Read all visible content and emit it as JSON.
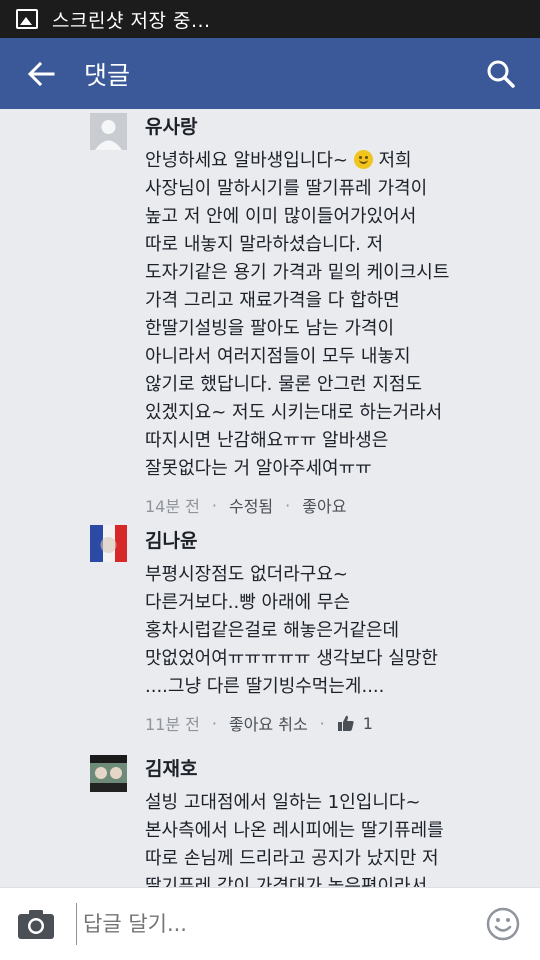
{
  "status_bar": {
    "text": "스크린샷 저장 중..."
  },
  "app_bar": {
    "title": "댓글"
  },
  "comments": [
    {
      "author": "유사랑",
      "lines": [
        "안녕하세요 알바생입니다~",
        "사장님이 말하시기를 딸기퓨레 가격이",
        "높고 저 안에 이미 많이들어가있어서",
        "따로 내놓지 말라하셨습니다. 저",
        "도자기같은 용기 가격과 밑의 케이크시트",
        "가격 그리고 재료가격을 다 합하면",
        "한딸기설빙을 팔아도 남는 가격이",
        "아니라서 여러지점들이 모두 내놓지",
        "않기로 했답니다. 물론 안그런 지점도",
        "있겠지요~ 저도 시키는대로 하는거라서",
        "따지시면 난감해요ㅠㅠ 알바생은",
        "잘못없다는 거 알아주세여ㅠㅠ"
      ],
      "line0_after_emoji": "저희",
      "time": "14분 전",
      "edited": "수정됨",
      "like": "좋아요"
    },
    {
      "author": "김나윤",
      "lines": [
        "부평시장점도 없더라구요~",
        "다른거보다..빵 아래에 무슨",
        "홍차시럽같은걸로 해놓은거같은데",
        "맛없었어여ㅠㅠㅠㅠㅠ 생각보다 실망한",
        "....그냥 다른 딸기빙수먹는게...."
      ],
      "time": "11분 전",
      "like_cancel": "좋아요 취소",
      "like_count": "1"
    },
    {
      "author": "김재호",
      "lines": [
        "설빙 고대점에서 일하는 1인입니다~",
        "본사측에서 나온 레시피에는 딸기퓨레를",
        "따로 손님께 드리라고 공지가 났지만 저",
        "딸기퓨레 값이 가격대가 높은편이라서"
      ]
    }
  ],
  "composer": {
    "placeholder": "답글 달기..."
  },
  "colors": {
    "header": "#3b5998",
    "background": "#e9ebee",
    "status_bar": "#1c1c1c"
  },
  "icons": [
    "image-icon",
    "back-arrow-icon",
    "search-icon",
    "camera-icon",
    "emoji-icon",
    "smiley-icon",
    "thumbs-up-icon"
  ]
}
